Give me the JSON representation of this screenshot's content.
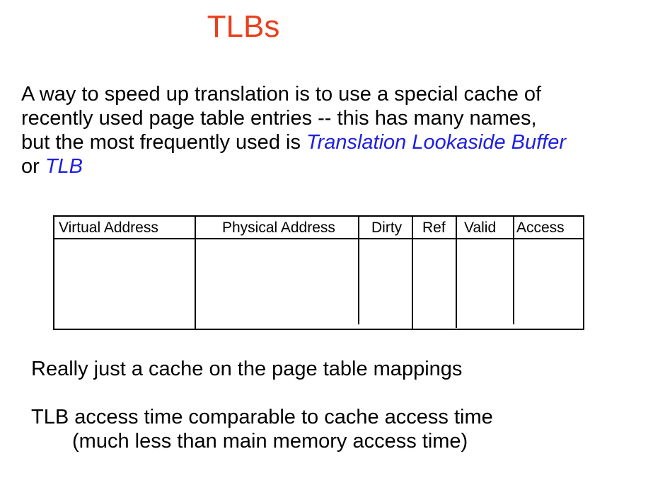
{
  "slide": {
    "title": "TLBs",
    "title_color": "#e8401c",
    "accent_color": "#1f1fe0",
    "intro": {
      "line1": "A way to speed up translation is to use a special cache of",
      "line2": "recently used page table entries  --  this has many names,",
      "line3_prefix": "but the most frequently used is ",
      "line3_emphasis": "Translation Lookaside Buffer",
      "line4_prefix": "or ",
      "line4_emphasis": "TLB"
    },
    "tlb_table": {
      "columns": [
        "Virtual Address",
        "Physical Address",
        "Dirty",
        "Ref",
        "Valid",
        "Access"
      ],
      "rows": []
    },
    "note1": "Really just a cache on the page table mappings",
    "note2": "TLB access time comparable to cache access time",
    "note3": "(much less than main memory access time)"
  }
}
